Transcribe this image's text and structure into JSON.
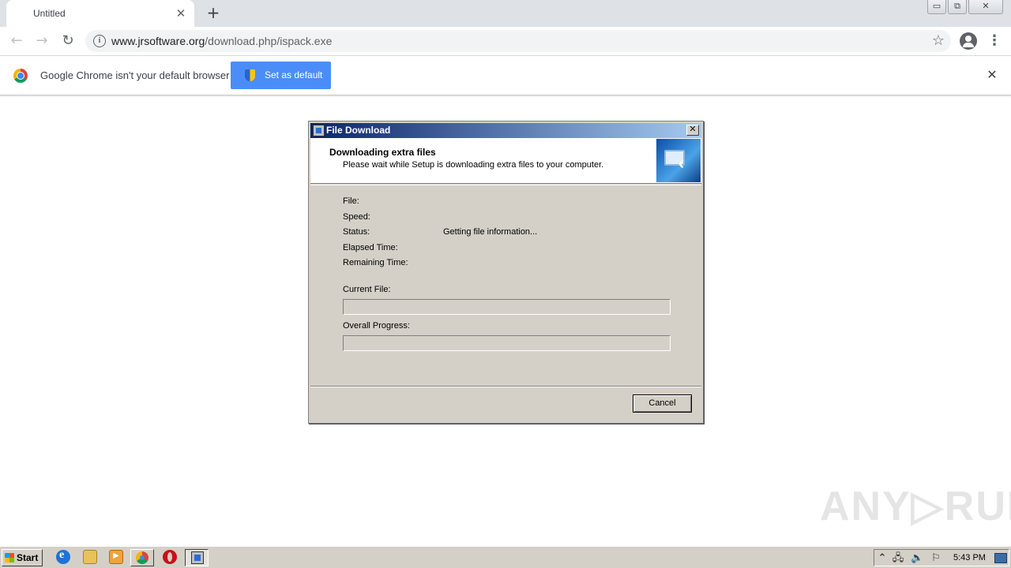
{
  "browser": {
    "tab_title": "Untitled",
    "tab_close_glyph": "✕",
    "new_tab_glyph": "+",
    "window_buttons": [
      "▭",
      "⧉",
      "✕"
    ],
    "nav": {
      "back_glyph": "←",
      "forward_glyph": "→",
      "reload_glyph": "↻",
      "star_glyph": "☆",
      "menu_glyph": "⋮",
      "info_glyph": "i"
    },
    "url_host": "www.jrsoftware.org",
    "url_path": "/download.php/ispack.exe"
  },
  "infobar": {
    "message": "Google Chrome isn't your default browser",
    "button_label": "Set as default",
    "close_glyph": "✕"
  },
  "dialog": {
    "title": "File Download",
    "close_glyph": "✕",
    "heading": "Downloading extra files",
    "subheading": "Please wait while Setup is downloading extra files to your computer.",
    "fields": [
      {
        "label": "File:",
        "value": ""
      },
      {
        "label": "Speed:",
        "value": ""
      },
      {
        "label": "Status:",
        "value": "Getting file information..."
      },
      {
        "label": "Elapsed Time:",
        "value": ""
      },
      {
        "label": "Remaining Time:",
        "value": ""
      }
    ],
    "current_file_label": "Current File:",
    "current_file_progress": 0,
    "overall_progress_label": "Overall Progress:",
    "overall_progress": 0,
    "cancel_label": "Cancel"
  },
  "watermark": "ANY▷RUN",
  "taskbar": {
    "start_label": "Start",
    "clock": "5:43 PM",
    "tray_glyphs": {
      "up": "⌃",
      "network": "🖧",
      "volume": "🔈",
      "flag": "⚐"
    }
  }
}
